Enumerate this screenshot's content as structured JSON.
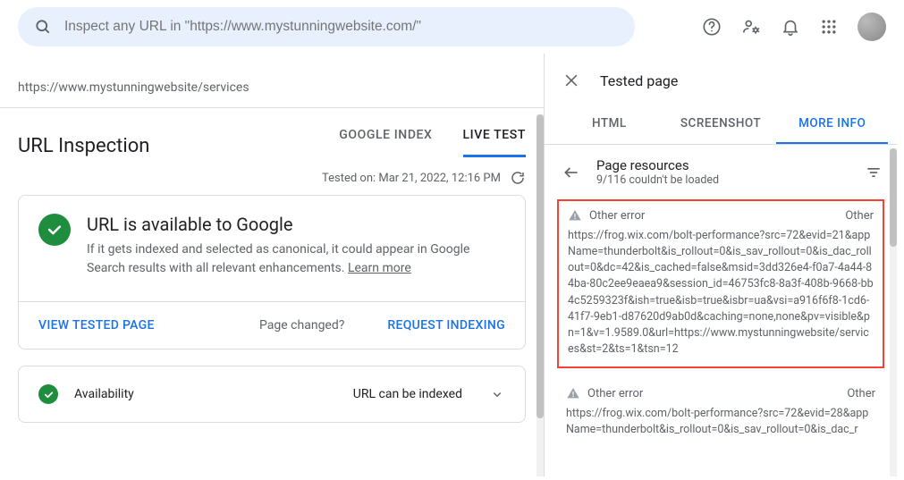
{
  "search": {
    "placeholder": "Inspect any URL in \"https://www.mystunningwebsite.com/\""
  },
  "inspected_url": "https://www.mystunningwebsite/services",
  "inspection": {
    "title": "URL Inspection",
    "tabs": {
      "google_index": "GOOGLE INDEX",
      "live_test": "LIVE TEST"
    },
    "tested_on": "Tested on: Mar 21, 2022, 12:16 PM"
  },
  "main_card": {
    "heading": "URL is available to Google",
    "sub": "If it gets indexed and selected as canonical, it could appear in Google Search results with all relevant enhancements. ",
    "learn_more": "Learn more",
    "view_tested": "VIEW TESTED PAGE",
    "page_changed": "Page changed?",
    "request_indexing": "REQUEST INDEXING"
  },
  "availability": {
    "label": "Availability",
    "status": "URL can be indexed"
  },
  "panel": {
    "title": "Tested page",
    "tabs": {
      "html": "HTML",
      "screenshot": "SCREENSHOT",
      "more_info": "MORE INFO"
    },
    "resources": {
      "title": "Page resources",
      "sub": "9/116 couldn't be loaded"
    },
    "error1": {
      "label": "Other error",
      "type": "Other",
      "url": "https://frog.wix.com/bolt-performance?src=72&evid=21&appName=thunderbolt&is_rollout=0&is_sav_rollout=0&is_dac_rollout=0&dc=42&is_cached=false&msid=3dd326e4-f0a7-4a44-84ba-80c2ee9eaea9&session_id=46753fc8-8a3f-408b-9668-bb4c5259323f&ish=true&isb=true&isbr=ua&vsi=a916f6f8-1cd6-41f7-9eb1-d87620d9ab0d&caching=none,none&pv=visible&pn=1&v=1.9589.0&url=https://www.mystunningwebsite/services&st=2&ts=1&tsn=12"
    },
    "error2": {
      "label": "Other error",
      "type": "Other",
      "url": "https://frog.wix.com/bolt-performance?src=72&evid=28&appName=thunderbolt&is_rollout=0&is_sav_rollout=0&is_dac_r"
    }
  }
}
